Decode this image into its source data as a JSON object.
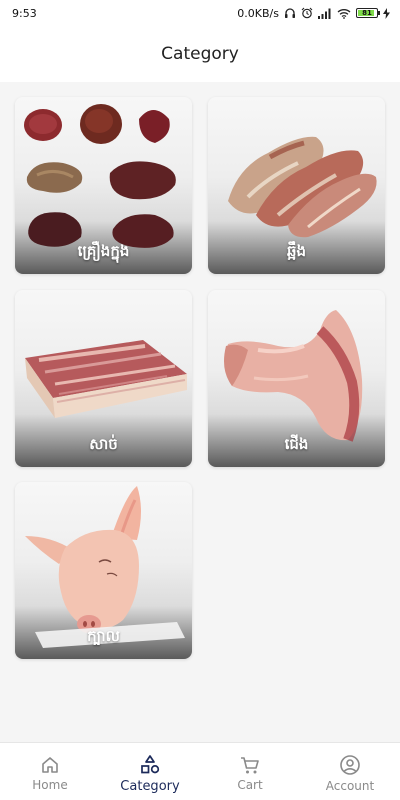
{
  "status_bar": {
    "time": "9:53",
    "network_speed": "0.0KB/s",
    "battery_level": "81",
    "icons": [
      "headphones-icon",
      "alarm-icon",
      "signal-icon",
      "wifi-icon",
      "battery-icon",
      "charging-icon"
    ]
  },
  "header": {
    "title": "Category"
  },
  "categories": [
    {
      "label": "គ្រឿងក្នុង",
      "icon": "offal-image"
    },
    {
      "label": "ឆ្អឹង",
      "icon": "bones-image"
    },
    {
      "label": "សាច់",
      "icon": "meat-slab-image"
    },
    {
      "label": "ជើង",
      "icon": "pork-leg-image"
    },
    {
      "label": "ក្បាល",
      "icon": "pig-head-image"
    }
  ],
  "bottom_nav": {
    "active": "Category",
    "items": [
      {
        "label": "Home",
        "icon": "home-icon"
      },
      {
        "label": "Category",
        "icon": "shapes-icon"
      },
      {
        "label": "Cart",
        "icon": "cart-icon"
      },
      {
        "label": "Account",
        "icon": "account-icon"
      }
    ]
  },
  "colors": {
    "accent": "#1c2a5a",
    "inactive": "#8a8a8a",
    "background": "#f5f5f5"
  }
}
